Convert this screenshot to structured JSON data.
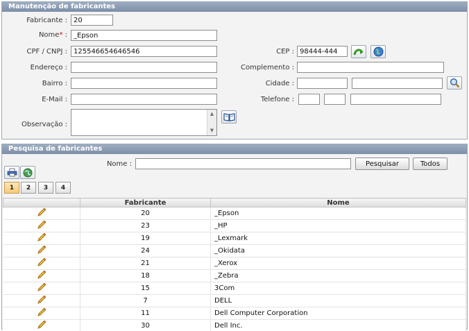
{
  "form_panel": {
    "title": "Manutenção de fabricantes",
    "fabricante": {
      "label": "Fabricante :",
      "value": "20"
    },
    "nome": {
      "label": "Nome",
      "required_mark": "*",
      "colon": " :",
      "value": "_Epson"
    },
    "cpf": {
      "label": "CPF / CNPJ :",
      "value": "125546654646546"
    },
    "cep": {
      "label": "CEP :",
      "value": "98444-444"
    },
    "endereco": {
      "label": "Endereço :",
      "value": ""
    },
    "complemento": {
      "label": "Complemento :",
      "value": ""
    },
    "bairro": {
      "label": "Bairro :",
      "value": ""
    },
    "cidade": {
      "label": "Cidade :",
      "value_code": "",
      "value_name": ""
    },
    "email": {
      "label": "E-Mail :",
      "value": ""
    },
    "telefone": {
      "label": "Telefone :",
      "ddi": "",
      "ddd": "",
      "number": ""
    },
    "observacao": {
      "label": "Observação :",
      "value": ""
    }
  },
  "search_panel": {
    "title": "Pesquisa de fabricantes",
    "nome_label": "Nome :",
    "nome_value": "",
    "search_button": "Pesquisar",
    "all_button": "Todos",
    "pages": [
      "1",
      "2",
      "3",
      "4"
    ],
    "active_page": "1"
  },
  "grid": {
    "columns": [
      "",
      "Fabricante",
      "Nome"
    ],
    "rows": [
      {
        "fabricante": "20",
        "nome": "_Epson"
      },
      {
        "fabricante": "23",
        "nome": "_HP"
      },
      {
        "fabricante": "19",
        "nome": "_Lexmark"
      },
      {
        "fabricante": "24",
        "nome": "_Okidata"
      },
      {
        "fabricante": "21",
        "nome": "_Xerox"
      },
      {
        "fabricante": "18",
        "nome": "_Zebra"
      },
      {
        "fabricante": "15",
        "nome": "3Com"
      },
      {
        "fabricante": "7",
        "nome": "DELL"
      },
      {
        "fabricante": "11",
        "nome": "Dell Computer Corporation"
      },
      {
        "fabricante": "30",
        "nome": "Dell Inc."
      }
    ]
  },
  "icons": {
    "cep_search": "green-arrow-icon",
    "cep_web": "globe-icon",
    "cidade_search": "magnifier-icon",
    "observacao_book": "book-icon",
    "print": "printer-icon",
    "export": "globe-export-icon",
    "row_edit": "pencil-icon"
  },
  "colors": {
    "header_bg": "#7d8ea8",
    "active_page": "#f8c978"
  }
}
